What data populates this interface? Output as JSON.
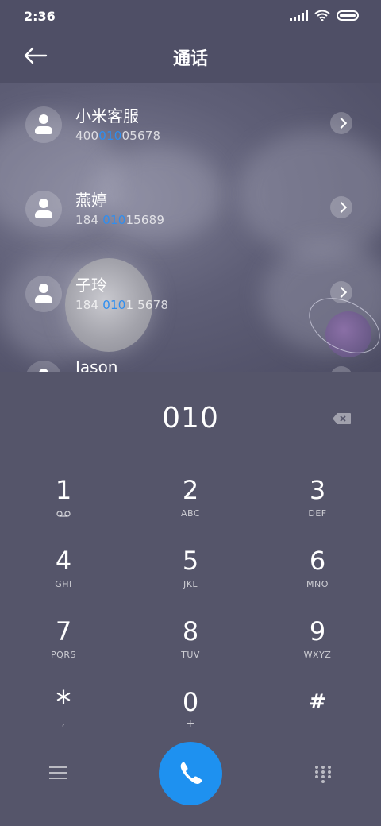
{
  "status_bar": {
    "time": "2:36"
  },
  "header": {
    "title": "通话"
  },
  "contacts": [
    {
      "name": "小米客服",
      "num_pre": "400",
      "num_match": "010",
      "num_post": "05678"
    },
    {
      "name": "燕婷",
      "num_pre": "184 ",
      "num_match": "010",
      "num_post": "15689"
    },
    {
      "name": "子玲",
      "num_pre": "184 ",
      "num_match": "010",
      "num_post": "1 5678"
    },
    {
      "name": "Jason",
      "num_pre": "",
      "num_match": "",
      "num_post": ""
    }
  ],
  "dialer": {
    "entered_number": "010",
    "keys": [
      {
        "digit": "1",
        "letters": ""
      },
      {
        "digit": "2",
        "letters": "ABC"
      },
      {
        "digit": "3",
        "letters": "DEF"
      },
      {
        "digit": "4",
        "letters": "GHI"
      },
      {
        "digit": "5",
        "letters": "JKL"
      },
      {
        "digit": "6",
        "letters": "MNO"
      },
      {
        "digit": "7",
        "letters": "PQRS"
      },
      {
        "digit": "8",
        "letters": "TUV"
      },
      {
        "digit": "9",
        "letters": "WXYZ"
      },
      {
        "digit": "*",
        "letters": ","
      },
      {
        "digit": "0",
        "letters": "+"
      },
      {
        "digit": "#",
        "letters": ""
      }
    ]
  },
  "icons": {
    "back": "back-arrow-icon",
    "backspace": "backspace-icon",
    "menu": "menu-icon",
    "call": "phone-icon",
    "dialpad": "dialpad-icon",
    "voicemail": "voicemail-icon"
  },
  "colors": {
    "accent": "#1e91f0",
    "highlight": "#2e8ef0",
    "background": "#55556a"
  }
}
